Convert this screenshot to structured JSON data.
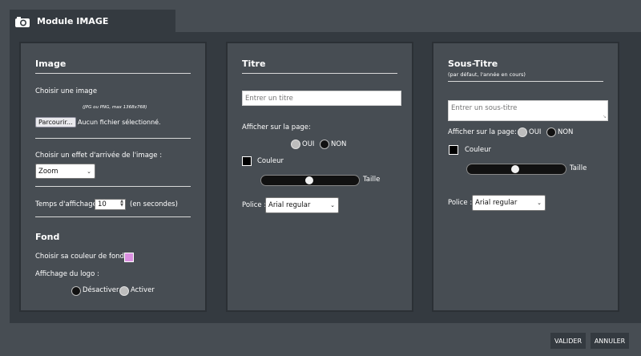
{
  "header": {
    "title": "Module IMAGE",
    "icon": "camera-icon"
  },
  "image_panel": {
    "heading": "Image",
    "choose_label": "Choisir une image",
    "format_hint": "(JPG ou PNG, max 1368x768)",
    "browse_label": "Parcourir...",
    "no_file_text": "Aucun fichier sélectionné.",
    "effect_label": "Choisir un effet d'arrivée de l'image :",
    "effect_value": "Zoom",
    "duration_label": "Temps d'affichage",
    "duration_value": "10",
    "duration_unit": "(en secondes)",
    "bg_heading": "Fond",
    "bg_color_label": "Choisir sa couleur de fond",
    "bg_color": "#da8fe0",
    "logo_label": "Affichage du logo :",
    "logo_off": "Désactiver",
    "logo_on": "Activer",
    "logo_selected": "Activer"
  },
  "title_panel": {
    "heading": "Titre",
    "input_placeholder": "Entrer un titre",
    "show_label": "Afficher sur la page:",
    "yes": "OUI",
    "no": "NON",
    "show_selected": "OUI",
    "color_label": "Couleur",
    "size_label": "Taille",
    "size_level": 0.49,
    "font_label": "Police :",
    "font_value": "Arial regular"
  },
  "subtitle_panel": {
    "heading": "Sous-Titre",
    "subheading": "(par défaut, l'année en cours)",
    "input_placeholder": "Entrer un sous-titre",
    "show_label": "Afficher sur la page:",
    "yes": "OUI",
    "no": "NON",
    "show_selected": "OUI",
    "color_label": "Couleur",
    "size_label": "Taille",
    "size_level": 0.49,
    "font_label": "Police :",
    "font_value": "Arial regular"
  },
  "actions": {
    "validate": "VALIDER",
    "cancel": "ANNULER"
  }
}
